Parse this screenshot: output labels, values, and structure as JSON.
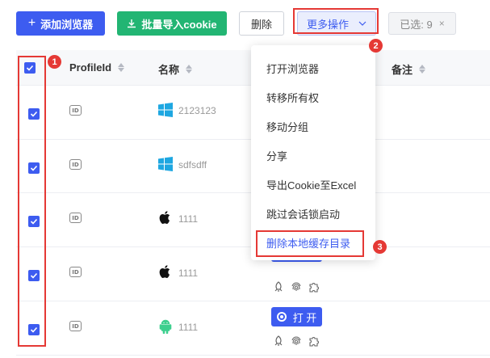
{
  "toolbar": {
    "add_browser_label": "添加浏览器",
    "import_cookie_label": "批量导入cookie",
    "delete_label": "删除",
    "more_actions_label": "更多操作",
    "selected_label": "已选: 9",
    "clear_label": "×"
  },
  "table": {
    "headers": [
      "ProfileId",
      "名称",
      "备注"
    ],
    "id_icon_text": "ID",
    "rows": [
      {
        "name": "2123123",
        "os": "windows-icon"
      },
      {
        "name": "sdfsdff",
        "os": "windows-icon"
      },
      {
        "name": "1111",
        "os": "apple-icon"
      },
      {
        "name": "1111",
        "os": "apple-icon"
      },
      {
        "name": "1111",
        "os": "android-icon"
      }
    ],
    "open_button_label": "打 开"
  },
  "dropdown": {
    "items": [
      "打开浏览器",
      "转移所有权",
      "移动分组",
      "分享",
      "导出Cookie至Excel",
      "跳过会话锁启动",
      "删除本地缓存目录"
    ]
  },
  "annotations": [
    "1",
    "2",
    "3"
  ],
  "colors": {
    "primary": "#3d5cf0",
    "success": "#22b573",
    "annotation": "#e53935"
  }
}
